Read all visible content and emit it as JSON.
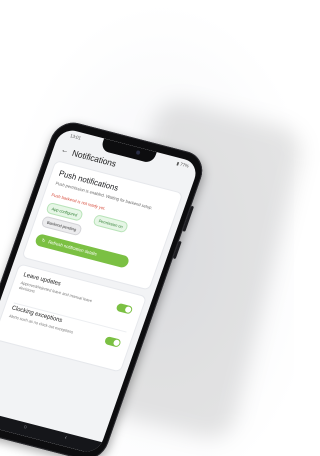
{
  "status": {
    "time": "13:01",
    "battery": "▮ 77%"
  },
  "appbar": {
    "back_icon": "←",
    "title": "Notifications"
  },
  "push": {
    "heading": "Push notifications",
    "description": "Push permission is enabled. Waiting for backend setup.",
    "warning": "Push backend is not ready yet.",
    "chips": {
      "app": "App configured",
      "permission": "Permission on",
      "pending": "Backend pending"
    },
    "refresh_icon": "↻",
    "refresh_label": "Refresh notification details"
  },
  "settings": {
    "leave": {
      "label": "Leave updates",
      "sub": "Approved/rejected leave and manual leave decisions",
      "enabled": true
    },
    "clocking": {
      "label": "Clocking exceptions",
      "sub": "Alerts such as no clock-out exceptions",
      "enabled": true
    }
  },
  "nav": {
    "recent_icon": "|||",
    "home_icon": "○",
    "back_icon": "‹"
  },
  "colors": {
    "accent": "#7bc043",
    "warning": "#d64a3a",
    "chip_green": "#e6f6e6"
  }
}
